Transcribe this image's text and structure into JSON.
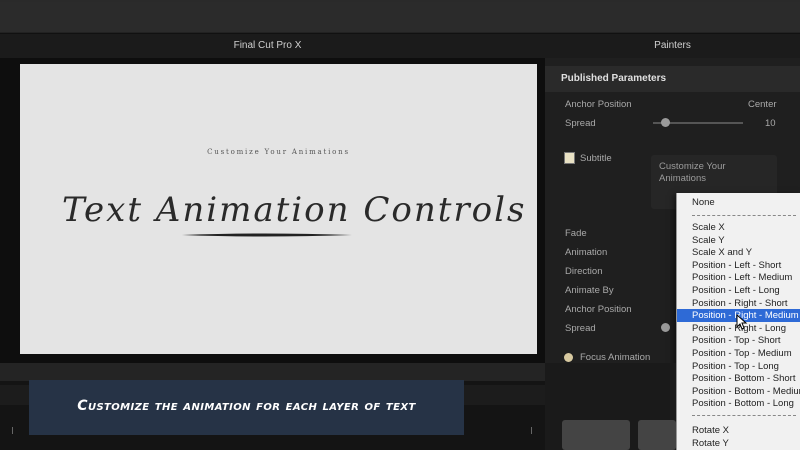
{
  "window": {
    "app_title": "Final Cut Pro X",
    "panel_title": "Painters"
  },
  "canvas": {
    "subtitle": "Customize Your Animations",
    "headline": "Text Animation Controls"
  },
  "inspector": {
    "header": "Published Parameters",
    "params_top": [
      {
        "label": "Anchor Position",
        "value": "Center"
      },
      {
        "label": "Spread",
        "value": "10"
      }
    ],
    "subtitle_label": "Subtitle",
    "subtitle_text": "Customize Your Animations",
    "params_bottom": [
      {
        "label": "Fade"
      },
      {
        "label": "Animation"
      },
      {
        "label": "Direction"
      },
      {
        "label": "Animate By"
      },
      {
        "label": "Anchor Position"
      },
      {
        "label": "Spread"
      }
    ],
    "focus_label": "Focus Animation"
  },
  "dropdown": {
    "first": "None",
    "items": [
      "Scale X",
      "Scale Y",
      "Scale X and Y",
      "Position - Left - Short",
      "Position - Left - Medium",
      "Position - Left - Long",
      "Position - Right - Short",
      "Position - Right - Medium",
      "Position - Right - Long",
      "Position - Top - Short",
      "Position - Top - Medium",
      "Position - Top - Long",
      "Position - Bottom - Short",
      "Position - Bottom - Medium",
      "Position - Bottom - Long"
    ],
    "selected_index": 7,
    "after": [
      "Rotate X",
      "Rotate Y"
    ]
  },
  "caption": "Customize the animation for each layer of text",
  "colors": {
    "selection": "#2e6ad6",
    "caption_bg": "#263346"
  }
}
